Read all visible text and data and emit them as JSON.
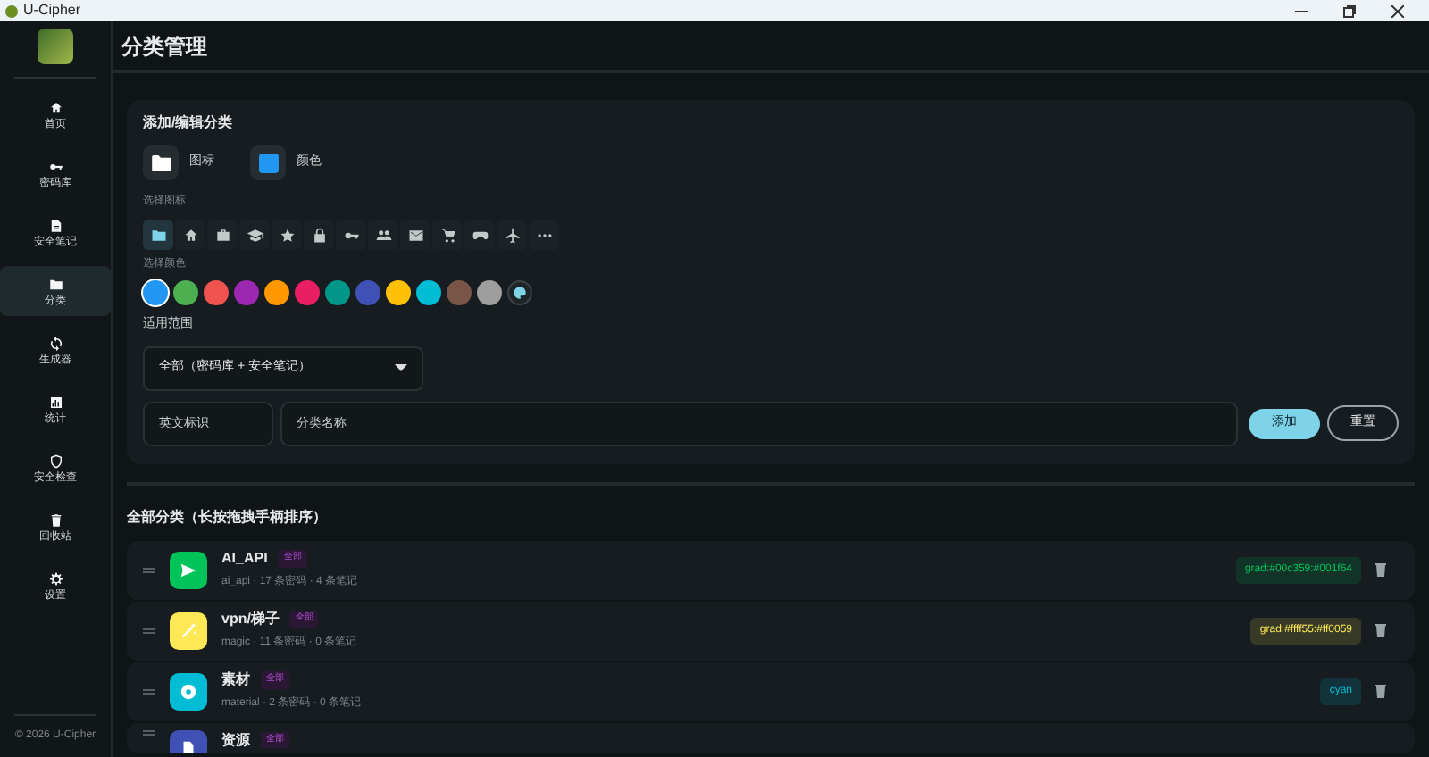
{
  "window": {
    "title": "U-Cipher"
  },
  "sidebar": {
    "items": [
      {
        "kind": "home",
        "label": "首页",
        "selected": false
      },
      {
        "kind": "key",
        "label": "密码库",
        "selected": false
      },
      {
        "kind": "note",
        "label": "安全笔记",
        "selected": false
      },
      {
        "kind": "folder",
        "label": "分类",
        "selected": true
      },
      {
        "kind": "sync",
        "label": "生成器",
        "selected": false
      },
      {
        "kind": "chart",
        "label": "统计",
        "selected": false
      },
      {
        "kind": "shield",
        "label": "安全检查",
        "selected": false
      },
      {
        "kind": "trash",
        "label": "回收站",
        "selected": false
      },
      {
        "kind": "gear",
        "label": "设置",
        "selected": false
      }
    ],
    "footer": "© 2026 U-Cipher"
  },
  "page_title": "分类管理",
  "form": {
    "title": "添加/编辑分类",
    "preview_icon_label": "图标",
    "preview_color_label": "颜色",
    "icon_label": "选择图标",
    "icons": [
      {
        "kind": "folder",
        "selected": true
      },
      {
        "kind": "home",
        "selected": false
      },
      {
        "kind": "briefcase",
        "selected": false
      },
      {
        "kind": "school",
        "selected": false
      },
      {
        "kind": "star",
        "selected": false
      },
      {
        "kind": "lock",
        "selected": false
      },
      {
        "kind": "key",
        "selected": false
      },
      {
        "kind": "people",
        "selected": false
      },
      {
        "kind": "mail",
        "selected": false
      },
      {
        "kind": "cart",
        "selected": false
      },
      {
        "kind": "gamepad",
        "selected": false
      },
      {
        "kind": "plane",
        "selected": false
      },
      {
        "kind": "more",
        "selected": false
      }
    ],
    "color_label": "选择颜色",
    "colors": [
      {
        "color": "#2196f3",
        "selected": true
      },
      {
        "color": "#4caf50",
        "selected": false
      },
      {
        "color": "#ef5350",
        "selected": false
      },
      {
        "color": "#9c27b0",
        "selected": false
      },
      {
        "color": "#ff9800",
        "selected": false
      },
      {
        "color": "#e91e63",
        "selected": false
      },
      {
        "color": "#009688",
        "selected": false
      },
      {
        "color": "#3f51b5",
        "selected": false
      },
      {
        "color": "#ffc107",
        "selected": false
      },
      {
        "color": "#00bcd4",
        "selected": false
      },
      {
        "color": "#795548",
        "selected": false
      },
      {
        "color": "#9e9e9e",
        "selected": false
      }
    ],
    "scope_label": "适用范围",
    "scope_value": "全部（密码库 + 安全笔记）",
    "key_placeholder": "英文标识",
    "name_placeholder": "分类名称",
    "buttons": [
      "添加",
      "重置"
    ]
  },
  "list_title": "全部分类（长按拖拽手柄排序）",
  "categories": [
    {
      "kind": "send",
      "name": "AI_API",
      "badge": "全部",
      "meta": "ai_api · 17 条密码 · 4 条笔记",
      "tag": "grad:#00c359:#001f64",
      "color": "#00c359"
    },
    {
      "kind": "wand",
      "name": "vpn/梯子",
      "badge": "全部",
      "meta": "magic · 11 条密码 · 0 条笔记",
      "tag": "grad:#ffff55:#ff0059",
      "color": "#ffe855"
    },
    {
      "kind": "disc",
      "name": "素材",
      "badge": "全部",
      "meta": "material · 2 条密码 · 0 条笔记",
      "tag": "cyan",
      "color": "#00bcd4"
    },
    {
      "kind": "file",
      "name": "资源",
      "badge": "全部",
      "color": "#3f51b5"
    }
  ]
}
